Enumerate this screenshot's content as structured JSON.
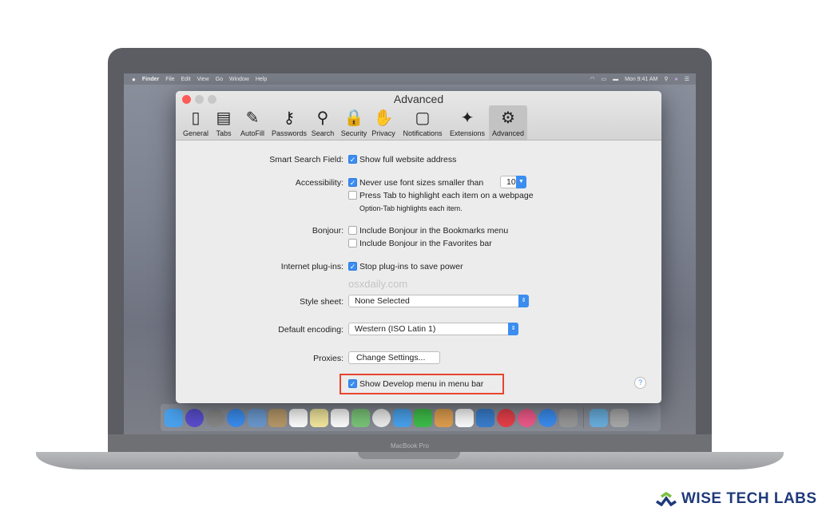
{
  "menubar": {
    "apple": "",
    "items": [
      "Finder",
      "File",
      "Edit",
      "View",
      "Go",
      "Window",
      "Help"
    ],
    "clock": "Mon 9:41 AM"
  },
  "window": {
    "title": "Advanced",
    "tabs": [
      {
        "label": "General",
        "icon": "switch-icon"
      },
      {
        "label": "Tabs",
        "icon": "tabs-icon"
      },
      {
        "label": "AutoFill",
        "icon": "pencil-icon"
      },
      {
        "label": "Passwords",
        "icon": "key-icon"
      },
      {
        "label": "Search",
        "icon": "magnifier-icon"
      },
      {
        "label": "Security",
        "icon": "lock-icon"
      },
      {
        "label": "Privacy",
        "icon": "hand-icon"
      },
      {
        "label": "Notifications",
        "icon": "notification-icon"
      },
      {
        "label": "Extensions",
        "icon": "puzzle-icon"
      },
      {
        "label": "Advanced",
        "icon": "gear-icon",
        "selected": true
      }
    ],
    "settings": {
      "smart_search_label": "Smart Search Field:",
      "smart_search_opt": "Show full website address",
      "smart_search_checked": true,
      "accessibility_label": "Accessibility:",
      "font_opt": "Never use font sizes smaller than",
      "font_checked": true,
      "font_size": "10",
      "tab_opt": "Press Tab to highlight each item on a webpage",
      "tab_checked": false,
      "tab_hint": "Option-Tab highlights each item.",
      "bonjour_label": "Bonjour:",
      "bonjour_bookmarks": "Include Bonjour in the Bookmarks menu",
      "bonjour_favorites": "Include Bonjour in the Favorites bar",
      "plugins_label": "Internet plug-ins:",
      "plugins_opt": "Stop plug-ins to save power",
      "plugins_checked": true,
      "watermark": "osxdaily.com",
      "stylesheet_label": "Style sheet:",
      "stylesheet_value": "None Selected",
      "encoding_label": "Default encoding:",
      "encoding_value": "Western (ISO Latin 1)",
      "proxies_label": "Proxies:",
      "proxies_button": "Change Settings...",
      "develop_opt": "Show Develop menu in menu bar",
      "develop_checked": true,
      "help": "?"
    },
    "highlight_color": "#e8442f"
  },
  "dock": [
    "finder",
    "siri",
    "launchpad",
    "safari",
    "preview",
    "notes-book",
    "calendar",
    "notes",
    "reminders",
    "maps",
    "photos",
    "messages",
    "facetime",
    "pages",
    "numbers",
    "keynote",
    "news",
    "music",
    "app-store",
    "system-preferences",
    "downloads",
    "trash"
  ],
  "laptop_label": "MacBook Pro",
  "brand": "WISE TECH LABS"
}
